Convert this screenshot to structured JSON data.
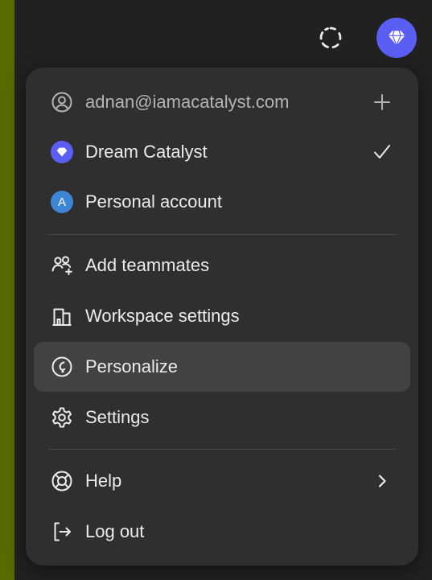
{
  "menu": {
    "account_email": "adnan@iamacatalyst.com",
    "workspaces": [
      {
        "label": "Dream Catalyst",
        "selected": true
      },
      {
        "label": "Personal account",
        "avatar_letter": "A"
      }
    ],
    "items": [
      {
        "label": "Add teammates"
      },
      {
        "label": "Workspace settings"
      },
      {
        "label": "Personalize"
      },
      {
        "label": "Settings"
      },
      {
        "label": "Help"
      },
      {
        "label": "Log out"
      }
    ]
  },
  "icons": {
    "top_loader": "loading-icon",
    "top_workspace": "diamond-icon",
    "account": "user-circle-icon",
    "add": "plus-icon",
    "check": "check-icon",
    "teammates": "users-plus-icon",
    "workspace_settings": "building-icon",
    "personalize": "personalize-icon",
    "settings": "gear-icon",
    "help": "lifebuoy-icon",
    "chevron": "chevron-right-icon",
    "logout": "logout-icon"
  },
  "colors": {
    "outer_background": "#556b00",
    "app_background": "#212121",
    "menu_background": "#2f2f2f",
    "active_item": "#424242",
    "workspace_accent": "#5b5ef3",
    "avatar": "#3d86d6",
    "text": "#ececec",
    "muted_text": "#b4b4b4"
  }
}
